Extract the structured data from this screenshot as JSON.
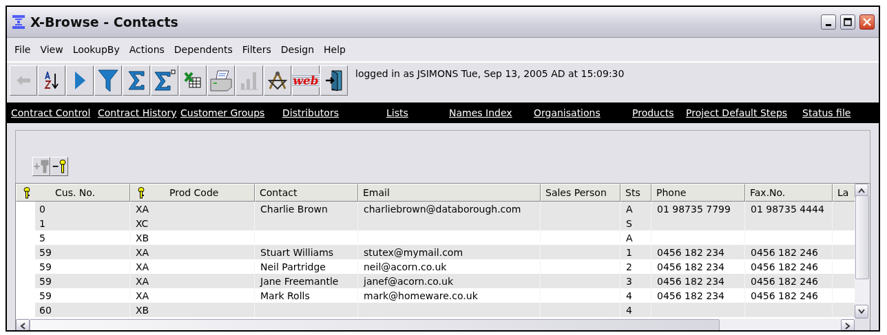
{
  "window": {
    "title": "X-Browse - Contacts"
  },
  "menu": [
    "File",
    "View",
    "LookupBy",
    "Actions",
    "Dependents",
    "Filters",
    "Design",
    "Help"
  ],
  "toolbar": [
    {
      "kind": "back",
      "disabled": true
    },
    {
      "kind": "sort",
      "disabled": false
    },
    {
      "kind": "play",
      "disabled": false
    },
    {
      "kind": "filter",
      "disabled": false
    },
    {
      "kind": "sum",
      "disabled": false
    },
    {
      "kind": "sumdot",
      "disabled": false
    },
    {
      "kind": "sheet",
      "disabled": false
    },
    {
      "kind": "printer",
      "disabled": false
    },
    {
      "kind": "chart",
      "disabled": true
    },
    {
      "kind": "tools",
      "disabled": false
    },
    {
      "kind": "web",
      "label": "web",
      "disabled": false
    },
    {
      "kind": "exit",
      "disabled": false
    }
  ],
  "status": "logged in as JSIMONS Tue, Sep 13, 2005 AD at 15:09:30",
  "links": [
    "Contract Control",
    "Contract History",
    "Customer Groups",
    "Distributors",
    "Lists",
    "Names Index",
    "Organisations",
    "Products",
    "Project Default Steps",
    "Status file"
  ],
  "key_buttons": [
    {
      "kind": "add-key",
      "label": "+",
      "disabled": true
    },
    {
      "kind": "remove-key",
      "label": "−",
      "disabled": false
    }
  ],
  "table": {
    "columns": [
      {
        "label": "Cus. No.",
        "key": true
      },
      {
        "label": "Prod Code",
        "key": true
      },
      {
        "label": "Contact",
        "key": false
      },
      {
        "label": "Email",
        "key": false
      },
      {
        "label": "Sales Person",
        "key": false
      },
      {
        "label": "Sts",
        "key": false
      },
      {
        "label": "Phone",
        "key": false
      },
      {
        "label": "Fax.No.",
        "key": false
      },
      {
        "label": "La",
        "key": false
      }
    ],
    "rows": [
      {
        "shaded": true,
        "cells": [
          "0",
          "XA",
          "Charlie Brown",
          "charliebrown@databorough.com",
          "",
          "A",
          "01 98735 7799",
          "01 98735 4444",
          ""
        ]
      },
      {
        "shaded": true,
        "cells": [
          "1",
          "XC",
          "",
          "",
          "",
          "S",
          "",
          "",
          ""
        ]
      },
      {
        "shaded": false,
        "cells": [
          "5",
          "XB",
          "",
          "",
          "",
          "A",
          "",
          "",
          ""
        ]
      },
      {
        "shaded": true,
        "cells": [
          "59",
          "XA",
          "Stuart Williams",
          "stutex@mymail.com",
          "",
          "1",
          "0456 182 234",
          "0456 182 246",
          ""
        ]
      },
      {
        "shaded": false,
        "cells": [
          "59",
          "XA",
          "Neil Partridge",
          "neil@acorn.co.uk",
          "",
          "2",
          "0456 182 234",
          "0456 182 246",
          ""
        ]
      },
      {
        "shaded": true,
        "cells": [
          "59",
          "XA",
          "Jane Freemantle",
          "janef@acorn.co.uk",
          "",
          "3",
          "0456 182 234",
          "0456 182 246",
          ""
        ]
      },
      {
        "shaded": false,
        "cells": [
          "59",
          "XA",
          "Mark Rolls",
          "mark@homeware.co.uk",
          "",
          "4",
          "0456 182 234",
          "0456 182 246",
          ""
        ]
      },
      {
        "shaded": true,
        "cells": [
          "60",
          "XB",
          "",
          "",
          "",
          "4",
          "",
          "",
          ""
        ]
      }
    ]
  }
}
